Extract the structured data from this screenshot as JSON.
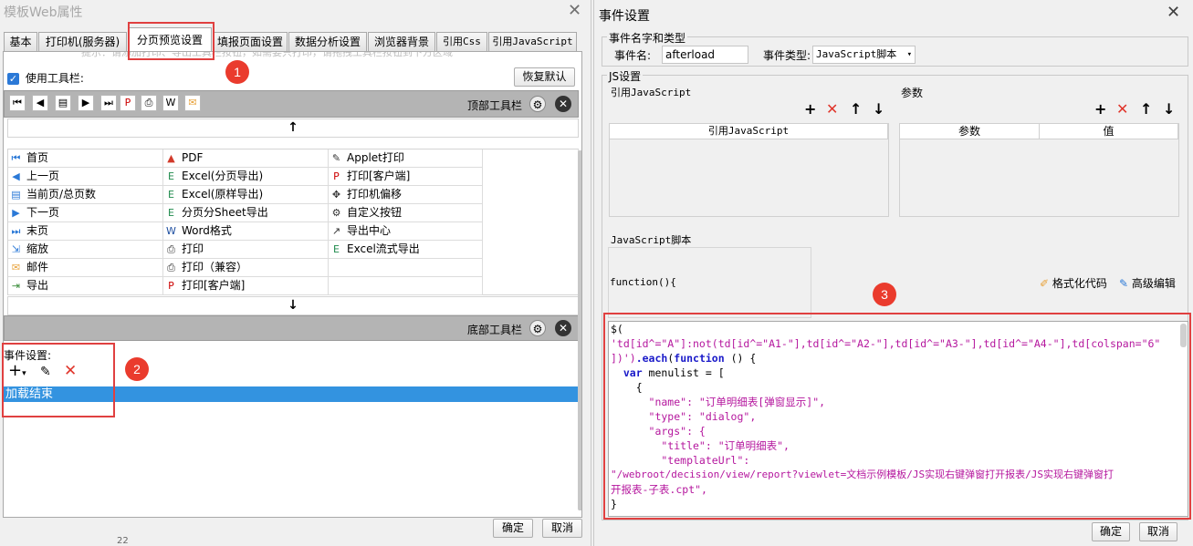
{
  "left_dialog": {
    "title": "模板Web属性",
    "close": "✕",
    "tabs": [
      "基本",
      "打印机(服务器)",
      "分页预览设置",
      "填报页面设置",
      "数据分析设置",
      "浏览器背景",
      "引用Css",
      "引用JavaScript"
    ],
    "active_tab": "分页预览设置",
    "hint": "提示：请添加打印、导出工具栏按钮，如需要只打印，请拖拽工具栏按钮到下方区域",
    "use_toolbar_label": "使用工具栏:",
    "restore_default": "恢复默认",
    "top_toolbar_label": "顶部工具栏",
    "bottom_toolbar_label": "底部工具栏",
    "arrow_up": "↑",
    "arrow_down": "↓",
    "grid": [
      {
        "icon": "first-page-icon",
        "glyph": "⏮",
        "label": "首页"
      },
      {
        "icon": "pdf-icon",
        "glyph": "▲",
        "label": "PDF"
      },
      {
        "icon": "applet-print-icon",
        "glyph": "✎",
        "label": "Applet打印"
      },
      {
        "icon": "prev-page-icon",
        "glyph": "◀",
        "label": "上一页"
      },
      {
        "icon": "excel-icon",
        "glyph": "E",
        "label": "Excel(分页导出)"
      },
      {
        "icon": "print-client-icon",
        "glyph": "P",
        "label": "打印[客户端]"
      },
      {
        "icon": "page-count-icon",
        "glyph": "▤",
        "label": "当前页/总页数"
      },
      {
        "icon": "excel-icon",
        "glyph": "E",
        "label": "Excel(原样导出)"
      },
      {
        "icon": "printer-offset-icon",
        "glyph": "✥",
        "label": "打印机偏移"
      },
      {
        "icon": "next-page-icon",
        "glyph": "▶",
        "label": "下一页"
      },
      {
        "icon": "excel-icon",
        "glyph": "E",
        "label": "分页分Sheet导出"
      },
      {
        "icon": "custom-button-icon",
        "glyph": "⚙",
        "label": "自定义按钮"
      },
      {
        "icon": "last-page-icon",
        "glyph": "⏭",
        "label": "末页"
      },
      {
        "icon": "word-icon",
        "glyph": "W",
        "label": "Word格式"
      },
      {
        "icon": "export-center-icon",
        "glyph": "↗",
        "label": "导出中心"
      },
      {
        "icon": "zoom-icon",
        "glyph": "⇲",
        "label": "缩放"
      },
      {
        "icon": "printer-icon",
        "glyph": "⎙",
        "label": "打印"
      },
      {
        "icon": "excel-icon",
        "glyph": "E",
        "label": "Excel流式导出"
      },
      {
        "icon": "mail-icon",
        "glyph": "✉",
        "label": "邮件"
      },
      {
        "icon": "printer-icon",
        "glyph": "⎙",
        "label": "打印（兼容）"
      },
      {
        "icon": "",
        "glyph": "",
        "label": ""
      },
      {
        "icon": "export-icon",
        "glyph": "⇥",
        "label": "导出"
      },
      {
        "icon": "print-client-icon",
        "glyph": "P",
        "label": "打印[客户端]"
      },
      {
        "icon": "",
        "glyph": "",
        "label": ""
      }
    ],
    "event_label": "事件设置:",
    "event_items": [
      "加载结束"
    ],
    "ok": "确定",
    "cancel": "取消",
    "footer_fragment": "22"
  },
  "right_dialog": {
    "title": "事件设置",
    "close": "✕",
    "name_type_legend": "事件名字和类型",
    "event_name_label": "事件名:",
    "event_name_value": "afterload",
    "event_type_label": "事件类型:",
    "event_type_value": "JavaScript脚本",
    "js_legend": "JS设置",
    "ref_js_legend": "引用JavaScript",
    "params_legend": "参数",
    "ref_js_col": "引用JavaScript",
    "param_col": "参数",
    "value_col": "值",
    "script_legend": "JavaScript脚本",
    "function_header": "function(){",
    "format_code": "格式化代码",
    "advanced_edit": "高级编辑",
    "code_lines": [
      "$(",
      "'td[id^=\"A\"]:not(td[id^=\"A1-\"],td[id^=\"A2-\"],td[id^=\"A3-\"],td[id^=\"A4-\"],td[colspan=\"6\"",
      "])').each(function () {",
      "  var menulist = [",
      "    {",
      "      \"name\": \"订单明细表[弹窗显示]\",",
      "      \"type\": \"dialog\",",
      "      \"args\": {",
      "        \"title\": \"订单明细表\",",
      "        \"templateUrl\":",
      "\"/webroot/decision/view/report?viewlet=文档示例模板/JS实现右键弹窗打开报表/JS实现右键弹窗打",
      "开报表-子表.cpt\",",
      "}"
    ],
    "ok": "确定",
    "cancel": "取消"
  },
  "badges": [
    "1",
    "2",
    "3"
  ],
  "colors": {
    "selection": "#3393e0",
    "highlight_frame": "#e04040",
    "badge": "#ea3b2d",
    "delete": "#e0352b"
  }
}
